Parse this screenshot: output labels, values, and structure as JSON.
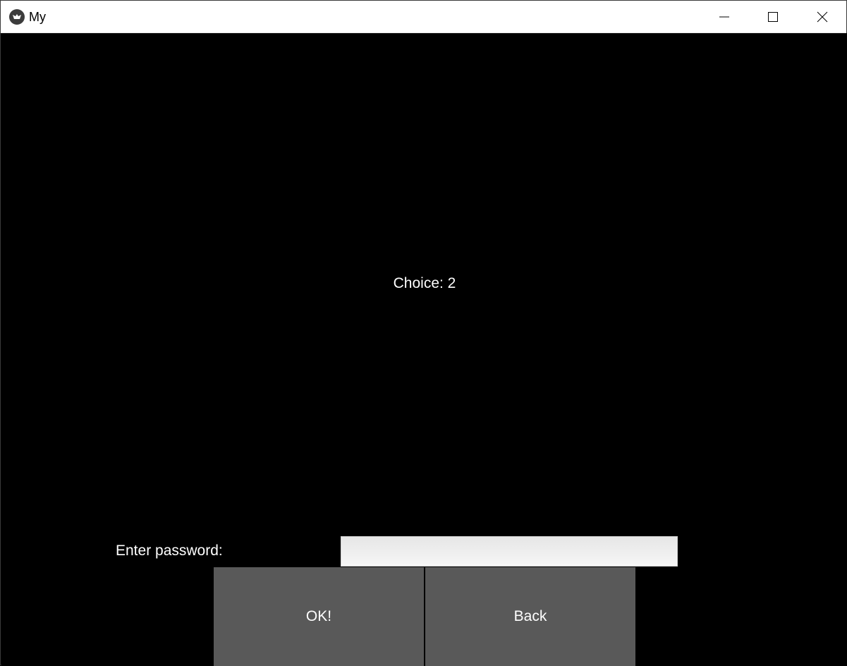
{
  "window": {
    "title": "My",
    "icon": "kivy-app-icon",
    "controls": {
      "minimize_icon": "minimize-icon",
      "maximize_icon": "maximize-icon",
      "close_icon": "close-icon"
    }
  },
  "main": {
    "choice_text": "Choice: 2",
    "password_label": "Enter password:",
    "password_value": "",
    "password_placeholder": "",
    "ok_label": "OK!",
    "back_label": "Back"
  },
  "colors": {
    "background": "#000000",
    "button": "#595959",
    "text": "#ffffff",
    "titlebar": "#ffffff"
  }
}
